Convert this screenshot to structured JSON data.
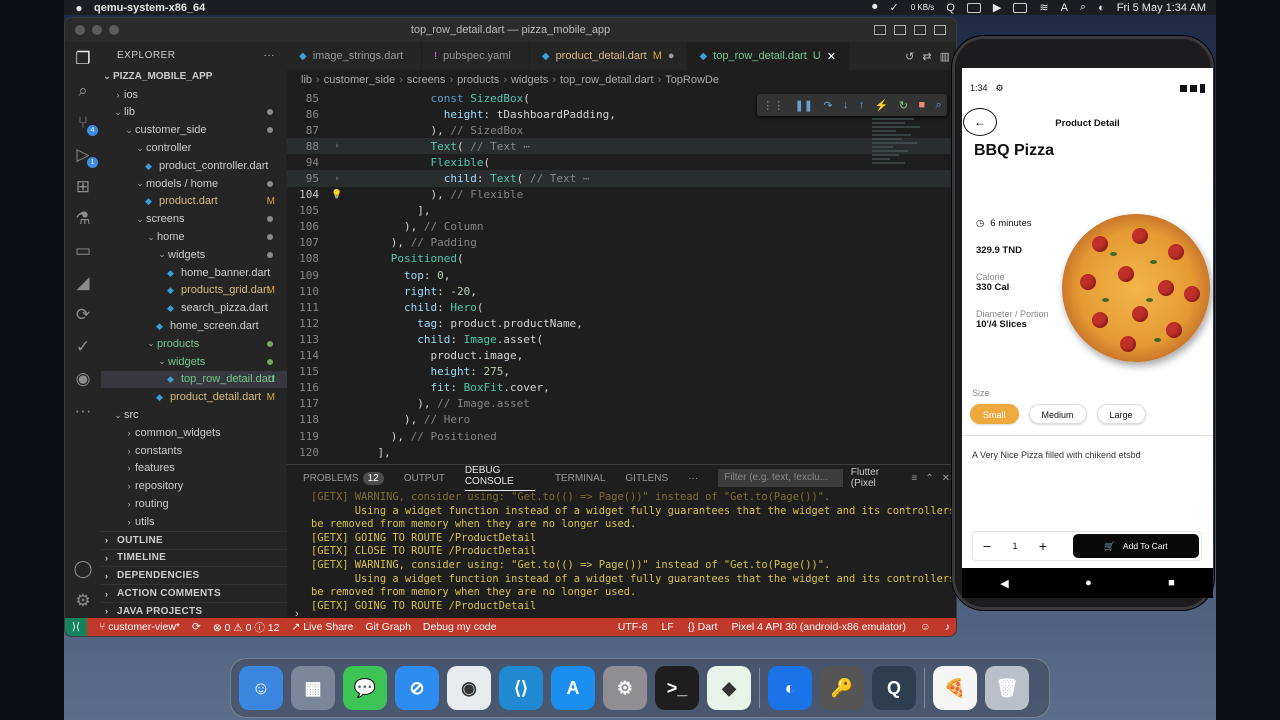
{
  "menubar": {
    "app": "qemu-system-x86_64",
    "net_up": "0 KB/s",
    "net_down": "0 KB/s",
    "input": "A",
    "datetime": "Fri 5 May  1:34 AM"
  },
  "window": {
    "title": "top_row_detail.dart — pizza_mobile_app"
  },
  "activity": {
    "scm_badge": "4",
    "debug_badge": "1"
  },
  "explorer": {
    "header": "EXPLORER",
    "more": "···",
    "project": "PIZZA_MOBILE_APP",
    "tree": [
      {
        "label": "ios",
        "indent": 1,
        "arrow": "›",
        "stat": ""
      },
      {
        "label": "lib",
        "indent": 1,
        "arrow": "⌄",
        "stat": "dot"
      },
      {
        "label": "customer_side",
        "indent": 2,
        "arrow": "⌄",
        "stat": "dot"
      },
      {
        "label": "controller",
        "indent": 3,
        "arrow": "⌄",
        "stat": ""
      },
      {
        "label": "product_controller.dart",
        "indent": 4,
        "arrow": "",
        "stat": "",
        "file": true
      },
      {
        "label": "models / home",
        "indent": 3,
        "arrow": "⌄",
        "stat": "dot"
      },
      {
        "label": "product.dart",
        "indent": 4,
        "arrow": "",
        "stat": "M",
        "file": true
      },
      {
        "label": "screens",
        "indent": 3,
        "arrow": "⌄",
        "stat": "dot"
      },
      {
        "label": "home",
        "indent": 4,
        "arrow": "⌄",
        "stat": "dot"
      },
      {
        "label": "widgets",
        "indent": 5,
        "arrow": "⌄",
        "stat": "dot"
      },
      {
        "label": "home_banner.dart",
        "indent": 6,
        "arrow": "",
        "stat": "",
        "file": true
      },
      {
        "label": "products_grid.dart",
        "indent": 6,
        "arrow": "",
        "stat": "M",
        "file": true
      },
      {
        "label": "search_pizza.dart",
        "indent": 6,
        "arrow": "",
        "stat": "",
        "file": true
      },
      {
        "label": "home_screen.dart",
        "indent": 5,
        "arrow": "",
        "stat": "",
        "file": true
      },
      {
        "label": "products",
        "indent": 4,
        "arrow": "⌄",
        "stat": "dotg"
      },
      {
        "label": "widgets",
        "indent": 5,
        "arrow": "⌄",
        "stat": "dotg"
      },
      {
        "label": "top_row_detail.dart",
        "indent": 6,
        "arrow": "",
        "stat": "U",
        "file": true,
        "selected": true
      },
      {
        "label": "product_detail.dart",
        "indent": 5,
        "arrow": "",
        "stat": "M",
        "file": true
      },
      {
        "label": "src",
        "indent": 1,
        "arrow": "⌄",
        "stat": ""
      },
      {
        "label": "common_widgets",
        "indent": 2,
        "arrow": "›",
        "stat": ""
      },
      {
        "label": "constants",
        "indent": 2,
        "arrow": "›",
        "stat": ""
      },
      {
        "label": "features",
        "indent": 2,
        "arrow": "›",
        "stat": ""
      },
      {
        "label": "repository",
        "indent": 2,
        "arrow": "›",
        "stat": ""
      },
      {
        "label": "routing",
        "indent": 2,
        "arrow": "›",
        "stat": ""
      },
      {
        "label": "utils",
        "indent": 2,
        "arrow": "›",
        "stat": ""
      }
    ],
    "sections": [
      "OUTLINE",
      "TIMELINE",
      "DEPENDENCIES",
      "ACTION COMMENTS",
      "JAVA PROJECTS"
    ]
  },
  "tabs": [
    {
      "label": "image_strings.dart",
      "mod": "",
      "type": "dart"
    },
    {
      "label": "pubspec.yaml",
      "mod": "",
      "type": "yaml"
    },
    {
      "label": "product_detail.dart",
      "mod": "M",
      "type": "dart"
    },
    {
      "label": "top_row_detail.dart",
      "mod": "U",
      "type": "dart",
      "active": true
    }
  ],
  "breadcrumb": [
    "lib",
    "customer_side",
    "screens",
    "products",
    "widgets",
    "top_row_detail.dart",
    "TopRowDe"
  ],
  "code": [
    {
      "n": "85",
      "fold": "",
      "html": "            <span class=\"kw\">const</span> <span class=\"cls\">SizedBox</span>("
    },
    {
      "n": "86",
      "fold": "",
      "html": "              <span class=\"prop\">height</span>: tDashboardPadding,"
    },
    {
      "n": "87",
      "fold": "",
      "html": "            ), <span class=\"cmt\">// SizedBox</span>"
    },
    {
      "n": "88",
      "fold": "›",
      "html": "            <span class=\"cls\">Text</span>( <span class=\"cmt\">// Text ⋯</span>",
      "hl": true
    },
    {
      "n": "94",
      "fold": "",
      "html": "            <span class=\"cls\">Flexible</span>("
    },
    {
      "n": "95",
      "fold": "›",
      "html": "              <span class=\"prop\">child</span>: <span class=\"cls\">Text</span>( <span class=\"cmt\">// Text ⋯</span>",
      "hl": true
    },
    {
      "n": "104",
      "fold": "bulb",
      "html": "            ), <span class=\"cmt\">// Flexible</span>",
      "cur": true
    },
    {
      "n": "105",
      "fold": "",
      "html": "          ],"
    },
    {
      "n": "106",
      "fold": "",
      "html": "        ), <span class=\"cmt\">// Column</span>"
    },
    {
      "n": "107",
      "fold": "",
      "html": "      ), <span class=\"cmt\">// Padding</span>"
    },
    {
      "n": "108",
      "fold": "",
      "html": "      <span class=\"cls\">Positioned</span>("
    },
    {
      "n": "109",
      "fold": "",
      "html": "        <span class=\"prop\">top</span>: <span class=\"num\">0</span>,"
    },
    {
      "n": "110",
      "fold": "",
      "html": "        <span class=\"prop\">right</span>: -<span class=\"num\">20</span>,"
    },
    {
      "n": "111",
      "fold": "",
      "html": "        <span class=\"prop\">child</span>: <span class=\"cls\">Hero</span>("
    },
    {
      "n": "112",
      "fold": "",
      "html": "          <span class=\"prop\">tag</span>: product.productName,"
    },
    {
      "n": "113",
      "fold": "",
      "html": "          <span class=\"prop\">child</span>: <span class=\"cls\">Image</span>.asset("
    },
    {
      "n": "114",
      "fold": "",
      "html": "            product.image,"
    },
    {
      "n": "115",
      "fold": "",
      "html": "            <span class=\"prop\">height</span>: <span class=\"num\">275</span>,"
    },
    {
      "n": "116",
      "fold": "",
      "html": "            <span class=\"prop\">fit</span>: <span class=\"cls\">BoxFit</span>.cover,"
    },
    {
      "n": "117",
      "fold": "",
      "html": "          ), <span class=\"cmt\">// Image.asset</span>"
    },
    {
      "n": "118",
      "fold": "",
      "html": "        ), <span class=\"cmt\">// Hero</span>"
    },
    {
      "n": "119",
      "fold": "",
      "html": "      ), <span class=\"cmt\">// Positioned</span>"
    },
    {
      "n": "120",
      "fold": "",
      "html": "    ],"
    }
  ],
  "panel": {
    "tabs": [
      {
        "label": "PROBLEMS",
        "count": "12"
      },
      {
        "label": "OUTPUT",
        "count": ""
      },
      {
        "label": "DEBUG CONSOLE",
        "count": "",
        "active": true
      },
      {
        "label": "TERMINAL",
        "count": ""
      },
      {
        "label": "GITLENS",
        "count": ""
      }
    ],
    "more": "···",
    "filter_placeholder": "Filter (e.g. text, !exclu...",
    "select": "Flutter (Pixel",
    "log": [
      {
        "t": "[GETX] WARNING, consider using: \"Get.to(() => Page())\" instead of \"Get.to(Page())\".",
        "dim": true
      },
      {
        "t": "       Using a widget function instead of a widget fully guarantees that the widget and its controllers will",
        "dim": false
      },
      {
        "t": "be removed from memory when they are no longer used.",
        "dim": false
      },
      {
        "t": "[GETX] GOING TO ROUTE /ProductDetail",
        "dim": false
      },
      {
        "t": "[GETX] CLOSE TO ROUTE /ProductDetail",
        "dim": false
      },
      {
        "t": "[GETX] WARNING, consider using: \"Get.to(() => Page())\" instead of \"Get.to(Page())\".",
        "dim": false
      },
      {
        "t": "       Using a widget function instead of a widget fully guarantees that the widget and its controllers will",
        "dim": false
      },
      {
        "t": "be removed from memory when they are no longer used.",
        "dim": false
      },
      {
        "t": "[GETX] GOING TO ROUTE /ProductDetail",
        "dim": false
      }
    ],
    "prompt": "›"
  },
  "status": {
    "branch": "customer-view*",
    "problems": "⊗ 0 ⚠ 0 ⓘ 12",
    "live_share": "Live Share",
    "git_graph": "Git Graph",
    "debug": "Debug my code",
    "encoding": "UTF-8",
    "eol": "LF",
    "lang": "{} Dart",
    "device": "Pixel 4 API 30 (android-x86 emulator)"
  },
  "phone": {
    "time": "1:34",
    "title": "Product Detail",
    "product_name": "BBQ Pizza",
    "duration": "6 minutes",
    "price": "329.9 TND",
    "calorie_label": "Calorie",
    "calorie_value": "330 Cal",
    "diameter_label": "Diameter / Portion",
    "diameter_value": "10'/4 Slices",
    "size_label": "Size",
    "sizes": [
      "Small",
      "Medium",
      "Large"
    ],
    "selected_size": "Small",
    "description": "A Very Nice Pizza filled with chikend etsbd",
    "quantity": "1",
    "add_to_cart": "Add To Cart"
  },
  "dock": [
    {
      "name": "finder",
      "bg": "#3b86e0",
      "glyph": "☺"
    },
    {
      "name": "launchpad",
      "bg": "#7a8699",
      "glyph": "▦"
    },
    {
      "name": "messages",
      "bg": "#3cc456",
      "glyph": "💬"
    },
    {
      "name": "safari",
      "bg": "#2d8cf0",
      "glyph": "⊘"
    },
    {
      "name": "chrome",
      "bg": "#e9ecef",
      "glyph": "◉"
    },
    {
      "name": "vscode",
      "bg": "#1f8ad2",
      "glyph": "⟨⟩"
    },
    {
      "name": "app-store",
      "bg": "#1c8ef2",
      "glyph": "A"
    },
    {
      "name": "settings",
      "bg": "#8e8e93",
      "glyph": "⚙"
    },
    {
      "name": "terminal",
      "bg": "#1e1e1e",
      "glyph": ">_"
    },
    {
      "name": "android-studio",
      "bg": "#e8f3ea",
      "glyph": "◆"
    },
    {
      "name": "sep",
      "bg": "",
      "glyph": ""
    },
    {
      "name": "remote-desktop",
      "bg": "#1a73e8",
      "glyph": "◐"
    },
    {
      "name": "keychain",
      "bg": "#555",
      "glyph": "🔑"
    },
    {
      "name": "quicktime",
      "bg": "#2c3e50",
      "glyph": "Q"
    },
    {
      "name": "sep",
      "bg": "",
      "glyph": ""
    },
    {
      "name": "pizza-image",
      "bg": "#f5f5f5",
      "glyph": "🍕"
    },
    {
      "name": "trash",
      "bg": "#b9c0c9",
      "glyph": "🗑"
    }
  ]
}
